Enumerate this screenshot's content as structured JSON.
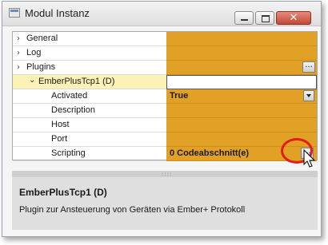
{
  "window": {
    "title": "Modul Instanz",
    "close_glyph": "✕"
  },
  "property_grid": {
    "rows": [
      {
        "label": "General",
        "value": "",
        "expander": "›",
        "state": "collapsed"
      },
      {
        "label": "Log",
        "value": "",
        "expander": "›",
        "state": "collapsed"
      },
      {
        "label": "Plugins",
        "value": "",
        "expander": "›",
        "state": "expanded",
        "ellipsis": "..."
      },
      {
        "label": "EmberPlusTcp1 (D)",
        "value": "",
        "expander": "⌄",
        "state": "expanded-selected"
      },
      {
        "label": "Activated",
        "value": "True",
        "dropdown": true
      },
      {
        "label": "Description",
        "value": ""
      },
      {
        "label": "Host",
        "value": ""
      },
      {
        "label": "Port",
        "value": ""
      },
      {
        "label": "Scripting",
        "value": "0 Codeabschnitt(e)",
        "ellipsis": "..."
      }
    ]
  },
  "help_panel": {
    "title": "EmberPlusTcp1 (D)",
    "description": "Plugin zur Ansteuerung von Geräten via Ember+ Protokoll"
  },
  "splitter": {
    "grip": "::::"
  },
  "colors": {
    "value_background": "#e0a126",
    "selected_row": "#fdf2b5",
    "highlight_ring": "#e21b1b",
    "close_button": "#c24a36"
  }
}
